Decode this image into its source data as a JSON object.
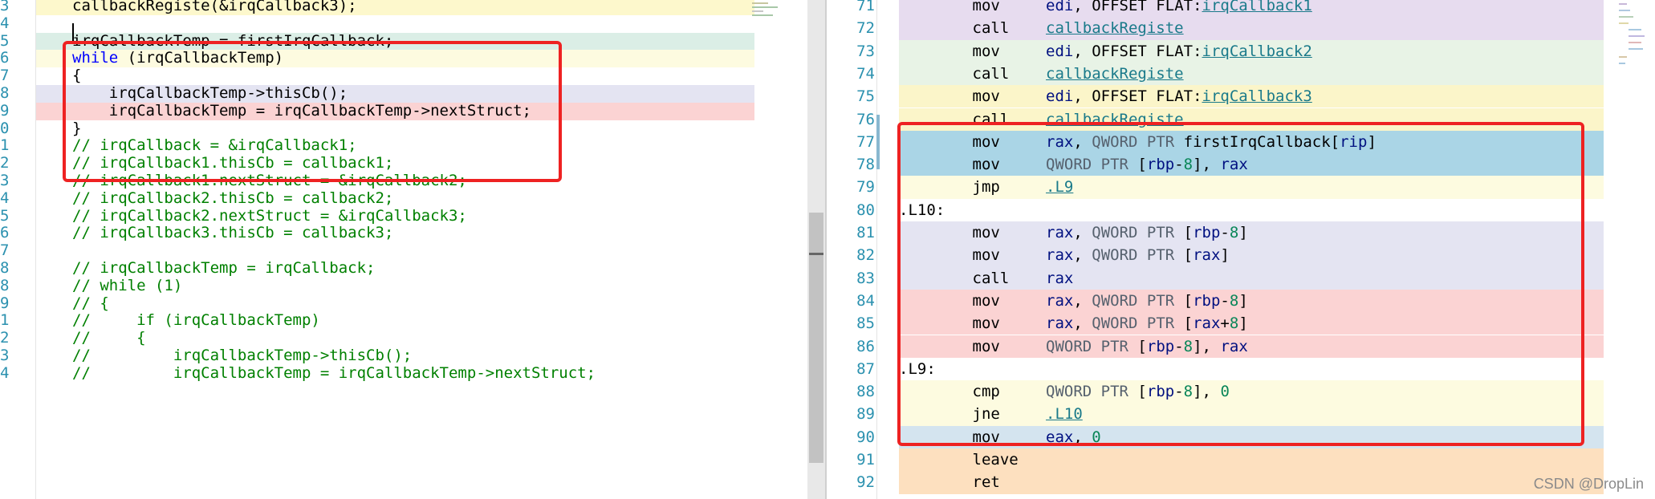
{
  "left_editor": {
    "lines": [
      {
        "num": "3",
        "bg": "#fdf8cc",
        "parts": [
          [
            "callbackRegiste(&irqCallback3);",
            "dk"
          ]
        ]
      },
      {
        "num": "4",
        "bg": "#ffffff",
        "parts": []
      },
      {
        "num": "5",
        "bg": "#dbeee6",
        "parts": [
          [
            "irqCallbackTemp = firstIrqCallback;",
            "dk"
          ]
        ]
      },
      {
        "num": "6",
        "bg": "#fdfbe0",
        "parts": [
          [
            "while",
            "kw"
          ],
          [
            " (irqCallbackTemp)",
            "dk"
          ]
        ]
      },
      {
        "num": "7",
        "bg": "#ffffff",
        "parts": [
          [
            "{",
            "dk"
          ]
        ]
      },
      {
        "num": "8",
        "bg": "#e4e4f2",
        "parts": [
          [
            "    irqCallbackTemp->thisCb();",
            "dk"
          ]
        ]
      },
      {
        "num": "9",
        "bg": "#fbd3d3",
        "parts": [
          [
            "    irqCallbackTemp = irqCallbackTemp->nextStruct;",
            "dk"
          ]
        ]
      },
      {
        "num": "0",
        "bg": "#ffffff",
        "parts": [
          [
            "}",
            "dk"
          ]
        ]
      },
      {
        "num": "1",
        "bg": "#ffffff",
        "parts": [
          [
            "// irqCallback = &irqCallback1;",
            "cm"
          ]
        ]
      },
      {
        "num": "2",
        "bg": "#ffffff",
        "parts": [
          [
            "// irqCallback1.thisCb = callback1;",
            "cm"
          ]
        ]
      },
      {
        "num": "3",
        "bg": "#ffffff",
        "parts": [
          [
            "// irqCallback1.nextStruct = &irqCallback2;",
            "cm"
          ]
        ]
      },
      {
        "num": "4",
        "bg": "#ffffff",
        "parts": [
          [
            "// irqCallback2.thisCb = callback2;",
            "cm"
          ]
        ]
      },
      {
        "num": "5",
        "bg": "#ffffff",
        "parts": [
          [
            "// irqCallback2.nextStruct = &irqCallback3;",
            "cm"
          ]
        ]
      },
      {
        "num": "6",
        "bg": "#ffffff",
        "parts": [
          [
            "// irqCallback3.thisCb = callback3;",
            "cm"
          ]
        ]
      },
      {
        "num": "7",
        "bg": "#ffffff",
        "parts": []
      },
      {
        "num": "8",
        "bg": "#ffffff",
        "parts": [
          [
            "// irqCallbackTemp = irqCallback;",
            "cm"
          ]
        ]
      },
      {
        "num": "8",
        "bg": "#ffffff",
        "parts": [
          [
            "// while (1)",
            "cm"
          ]
        ]
      },
      {
        "num": "9",
        "bg": "#ffffff",
        "parts": [
          [
            "// {",
            "cm"
          ]
        ]
      },
      {
        "num": "1",
        "bg": "#ffffff",
        "parts": [
          [
            "//     if (irqCallbackTemp)",
            "cm"
          ]
        ]
      },
      {
        "num": "2",
        "bg": "#ffffff",
        "parts": [
          [
            "//     {",
            "cm"
          ]
        ]
      },
      {
        "num": "3",
        "bg": "#ffffff",
        "parts": [
          [
            "//         irqCallbackTemp->thisCb();",
            "cm"
          ]
        ]
      },
      {
        "num": "4",
        "bg": "#ffffff",
        "parts": [
          [
            "//         irqCallbackTemp = irqCallbackTemp->nextStruct;",
            "cm"
          ]
        ]
      }
    ]
  },
  "right_editor": {
    "lines": [
      {
        "num": "71",
        "bg": "#e7dcef",
        "parts": [
          [
            "        mov     ",
            "dk"
          ],
          [
            "edi",
            "reg"
          ],
          [
            ", OFFSET FLAT:",
            "dk"
          ],
          [
            "irqCallback1",
            "lbl"
          ]
        ]
      },
      {
        "num": "72",
        "bg": "#e7dcef",
        "parts": [
          [
            "        call    ",
            "dk"
          ],
          [
            "callbackRegiste",
            "lbl"
          ]
        ]
      },
      {
        "num": "73",
        "bg": "#e8f3e6",
        "parts": [
          [
            "        mov     ",
            "dk"
          ],
          [
            "edi",
            "reg"
          ],
          [
            ", OFFSET FLAT:",
            "dk"
          ],
          [
            "irqCallback2",
            "lbl"
          ]
        ]
      },
      {
        "num": "74",
        "bg": "#e8f3e6",
        "parts": [
          [
            "        call    ",
            "dk"
          ],
          [
            "callbackRegiste",
            "lbl"
          ]
        ]
      },
      {
        "num": "75",
        "bg": "#fbf5c9",
        "parts": [
          [
            "        mov     ",
            "dk"
          ],
          [
            "edi",
            "reg"
          ],
          [
            ", OFFSET FLAT:",
            "dk"
          ],
          [
            "irqCallback3",
            "lbl"
          ]
        ]
      },
      {
        "num": "76",
        "bg": "#fbf5c9",
        "parts": [
          [
            "        call    ",
            "dk"
          ],
          [
            "callbackRegiste",
            "lbl"
          ]
        ]
      },
      {
        "num": "77",
        "bg": "#aad5e6",
        "parts": [
          [
            "        mov     ",
            "dk"
          ],
          [
            "rax",
            "reg"
          ],
          [
            ", ",
            "dk"
          ],
          [
            "QWORD PTR",
            "ptr"
          ],
          [
            " firstIrqCallback[",
            "dk"
          ],
          [
            "rip",
            "reg"
          ],
          [
            "]",
            "dk"
          ]
        ]
      },
      {
        "num": "78",
        "bg": "#aad5e6",
        "parts": [
          [
            "        mov     ",
            "dk"
          ],
          [
            "QWORD PTR",
            "ptr"
          ],
          [
            " [",
            "dk"
          ],
          [
            "rbp",
            "reg"
          ],
          [
            "-",
            "dk"
          ],
          [
            "8",
            "num"
          ],
          [
            "], ",
            "dk"
          ],
          [
            "rax",
            "reg"
          ]
        ]
      },
      {
        "num": "79",
        "bg": "#fdfbe0",
        "parts": [
          [
            "        jmp     ",
            "dk"
          ],
          [
            ".L9",
            "lbl"
          ]
        ]
      },
      {
        "num": "80",
        "bg": "#ffffff",
        "parts": [
          [
            ".L10:",
            "dk"
          ]
        ]
      },
      {
        "num": "81",
        "bg": "#e4e4f2",
        "parts": [
          [
            "        mov     ",
            "dk"
          ],
          [
            "rax",
            "reg"
          ],
          [
            ", ",
            "dk"
          ],
          [
            "QWORD PTR",
            "ptr"
          ],
          [
            " [",
            "dk"
          ],
          [
            "rbp",
            "reg"
          ],
          [
            "-",
            "dk"
          ],
          [
            "8",
            "num"
          ],
          [
            "]",
            "dk"
          ]
        ]
      },
      {
        "num": "82",
        "bg": "#e4e4f2",
        "parts": [
          [
            "        mov     ",
            "dk"
          ],
          [
            "rax",
            "reg"
          ],
          [
            ", ",
            "dk"
          ],
          [
            "QWORD PTR",
            "ptr"
          ],
          [
            " [",
            "dk"
          ],
          [
            "rax",
            "reg"
          ],
          [
            "]",
            "dk"
          ]
        ]
      },
      {
        "num": "83",
        "bg": "#e4e4f2",
        "parts": [
          [
            "        call    ",
            "dk"
          ],
          [
            "rax",
            "reg"
          ]
        ]
      },
      {
        "num": "84",
        "bg": "#fbd3d3",
        "parts": [
          [
            "        mov     ",
            "dk"
          ],
          [
            "rax",
            "reg"
          ],
          [
            ", ",
            "dk"
          ],
          [
            "QWORD PTR",
            "ptr"
          ],
          [
            " [",
            "dk"
          ],
          [
            "rbp",
            "reg"
          ],
          [
            "-",
            "dk"
          ],
          [
            "8",
            "num"
          ],
          [
            "]",
            "dk"
          ]
        ]
      },
      {
        "num": "85",
        "bg": "#fbd3d3",
        "parts": [
          [
            "        mov     ",
            "dk"
          ],
          [
            "rax",
            "reg"
          ],
          [
            ", ",
            "dk"
          ],
          [
            "QWORD PTR",
            "ptr"
          ],
          [
            " [",
            "dk"
          ],
          [
            "rax",
            "reg"
          ],
          [
            "+",
            "dk"
          ],
          [
            "8",
            "num"
          ],
          [
            "]",
            "dk"
          ]
        ]
      },
      {
        "num": "86",
        "bg": "#fbd3d3",
        "parts": [
          [
            "        mov     ",
            "dk"
          ],
          [
            "QWORD PTR",
            "ptr"
          ],
          [
            " [",
            "dk"
          ],
          [
            "rbp",
            "reg"
          ],
          [
            "-",
            "dk"
          ],
          [
            "8",
            "num"
          ],
          [
            "], ",
            "dk"
          ],
          [
            "rax",
            "reg"
          ]
        ]
      },
      {
        "num": "87",
        "bg": "#ffffff",
        "parts": [
          [
            ".L9:",
            "dk"
          ]
        ]
      },
      {
        "num": "88",
        "bg": "#fdfbe0",
        "parts": [
          [
            "        cmp     ",
            "dk"
          ],
          [
            "QWORD PTR",
            "ptr"
          ],
          [
            " [",
            "dk"
          ],
          [
            "rbp",
            "reg"
          ],
          [
            "-",
            "dk"
          ],
          [
            "8",
            "num"
          ],
          [
            "], ",
            "dk"
          ],
          [
            "0",
            "num"
          ]
        ]
      },
      {
        "num": "89",
        "bg": "#fdfbe0",
        "parts": [
          [
            "        jne     ",
            "dk"
          ],
          [
            ".L10",
            "lbl"
          ]
        ]
      },
      {
        "num": "90",
        "bg": "#d4e4ef",
        "parts": [
          [
            "        mov     ",
            "dk"
          ],
          [
            "eax",
            "reg"
          ],
          [
            ", ",
            "dk"
          ],
          [
            "0",
            "num"
          ]
        ]
      },
      {
        "num": "91",
        "bg": "#fde0bf",
        "parts": [
          [
            "        leave",
            "dk"
          ]
        ]
      },
      {
        "num": "92",
        "bg": "#fde0bf",
        "parts": [
          [
            "        ret",
            "dk"
          ]
        ]
      }
    ]
  },
  "watermark": "CSDN @DropLin",
  "colors": {
    "highlight_box": "#ee2222",
    "line_number": "#2b91af"
  }
}
